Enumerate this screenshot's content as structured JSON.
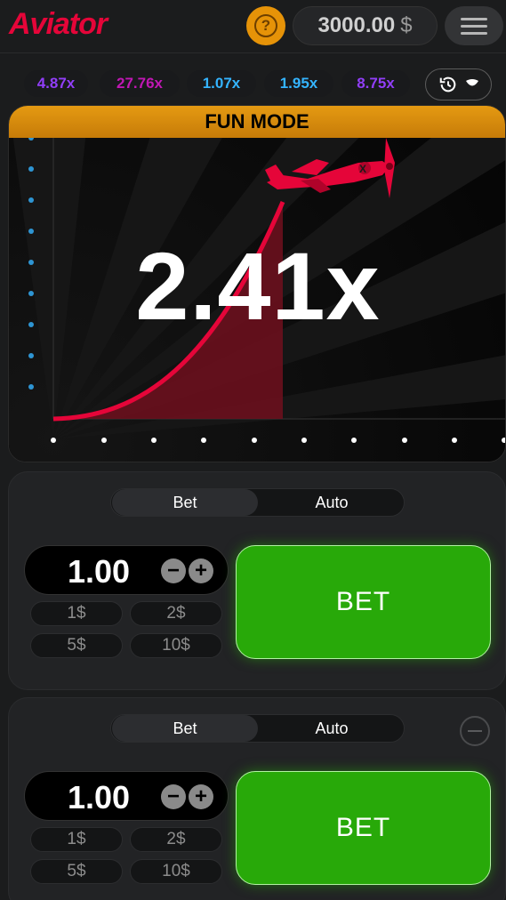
{
  "header": {
    "logo": "Aviator",
    "help_icon": "?",
    "balance_amount": "3000.00",
    "balance_currency": "$"
  },
  "history": {
    "multipliers": [
      "4.87x",
      "27.76x",
      "1.07x",
      "1.95x",
      "8.75x"
    ]
  },
  "game": {
    "mode_label": "FUN MODE",
    "multiplier": "2.41x"
  },
  "bet_panels": [
    {
      "tab_bet": "Bet",
      "tab_auto": "Auto",
      "amount": "1.00",
      "minus": "−",
      "plus": "+",
      "quick": [
        "1$",
        "2$",
        "5$",
        "10$"
      ],
      "bet_label": "BET"
    },
    {
      "tab_bet": "Bet",
      "tab_auto": "Auto",
      "amount": "1.00",
      "minus": "−",
      "plus": "+",
      "quick": [
        "1$",
        "2$",
        "5$",
        "10$"
      ],
      "bet_label": "BET"
    }
  ],
  "colors": {
    "brand_red": "#e50539",
    "fun_mode_orange": "#e59a12",
    "bet_green": "#28a909",
    "purple": "#913ef8",
    "blue": "#34b4ff",
    "magenta": "#c017b4"
  }
}
